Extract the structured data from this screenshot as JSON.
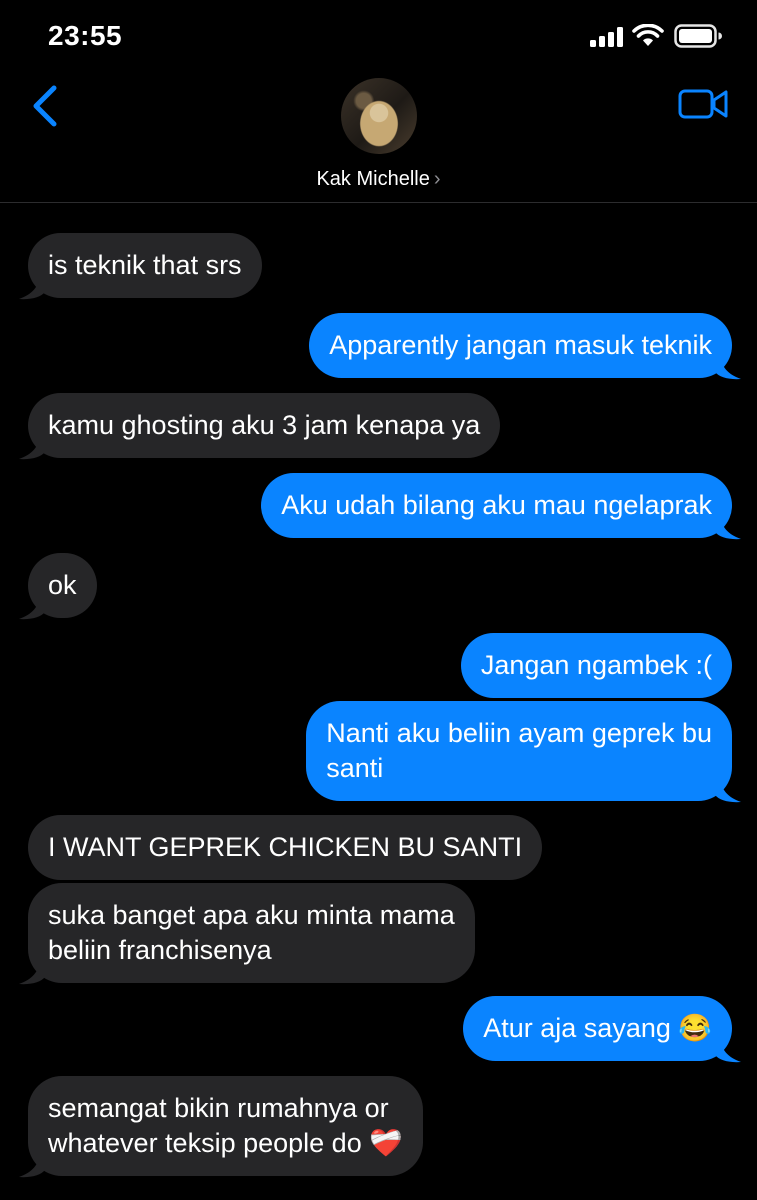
{
  "status": {
    "time": "23:55"
  },
  "header": {
    "contact_name": "Kak Michelle",
    "chevron": "›",
    "icons": {
      "back": "chevron-left-icon",
      "video": "video-camera-icon"
    },
    "accent": "#0a84ff"
  },
  "messages": [
    {
      "sender": "them",
      "lines": [
        "is teknik that srs"
      ]
    },
    {
      "sender": "me",
      "lines": [
        "Apparently jangan masuk teknik"
      ]
    },
    {
      "sender": "them",
      "lines": [
        "kamu ghosting aku 3 jam kenapa ya"
      ]
    },
    {
      "sender": "me",
      "lines": [
        "Aku udah bilang aku mau ngelaprak"
      ]
    },
    {
      "sender": "them",
      "lines": [
        "ok"
      ]
    },
    {
      "sender": "me",
      "lines": [
        "Jangan ngambek :("
      ]
    },
    {
      "sender": "me",
      "lines": [
        "Nanti aku beliin ayam geprek bu",
        "santi"
      ]
    },
    {
      "sender": "them",
      "lines": [
        "I WANT GEPREK CHICKEN BU SANTI"
      ]
    },
    {
      "sender": "them",
      "lines": [
        "suka banget apa aku minta mama",
        "beliin franchisenya"
      ]
    },
    {
      "sender": "me",
      "lines": [
        "Atur aja sayang 😂"
      ]
    },
    {
      "sender": "them",
      "lines": [
        "semangat bikin rumahnya or",
        "whatever teksip people do ❤️‍🩹"
      ]
    }
  ],
  "colors": {
    "incoming_bubble": "#262628",
    "outgoing_bubble": "#0a84ff"
  }
}
